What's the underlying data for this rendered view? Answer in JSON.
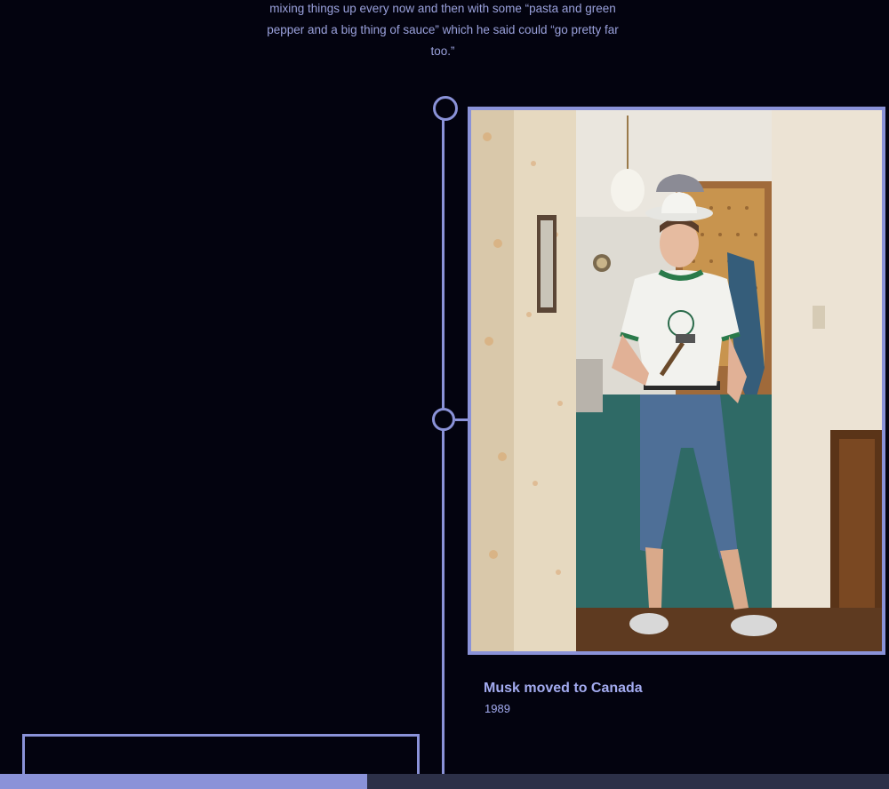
{
  "story": {
    "intro_text": "mixing things up every now and then with some “pasta and green pepper and a big thing of sauce” which he said could “go pretty far too.”"
  },
  "timeline": {
    "entry": {
      "title": "Musk moved to Canada",
      "year": "1989",
      "photo_icon": "photo-young-man-in-cowboy-hat-with-hammer"
    }
  },
  "progress": {
    "fraction": 0.413
  },
  "colors": {
    "background": "#03030f",
    "accent": "#8a92d8",
    "text": "#9aa1dc",
    "track": "#2c3048"
  }
}
